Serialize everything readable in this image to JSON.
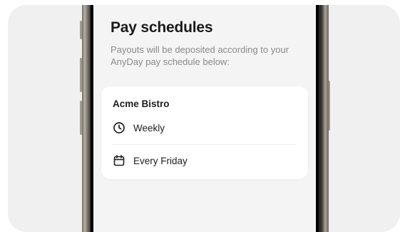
{
  "page": {
    "title": "Pay schedules",
    "subtitle": "Payouts will be deposited according to your AnyDay pay schedule below:"
  },
  "schedule_card": {
    "employer": "Acme Bistro",
    "frequency": {
      "icon": "clock-icon",
      "label": "Weekly"
    },
    "payday": {
      "icon": "calendar-icon",
      "label": "Every Friday"
    }
  },
  "colors": {
    "background": "#f0f0f0",
    "screen": "#f4f4f4",
    "card": "#ffffff",
    "title_text": "#1a1a1a",
    "muted_text": "#8a8a8a"
  }
}
